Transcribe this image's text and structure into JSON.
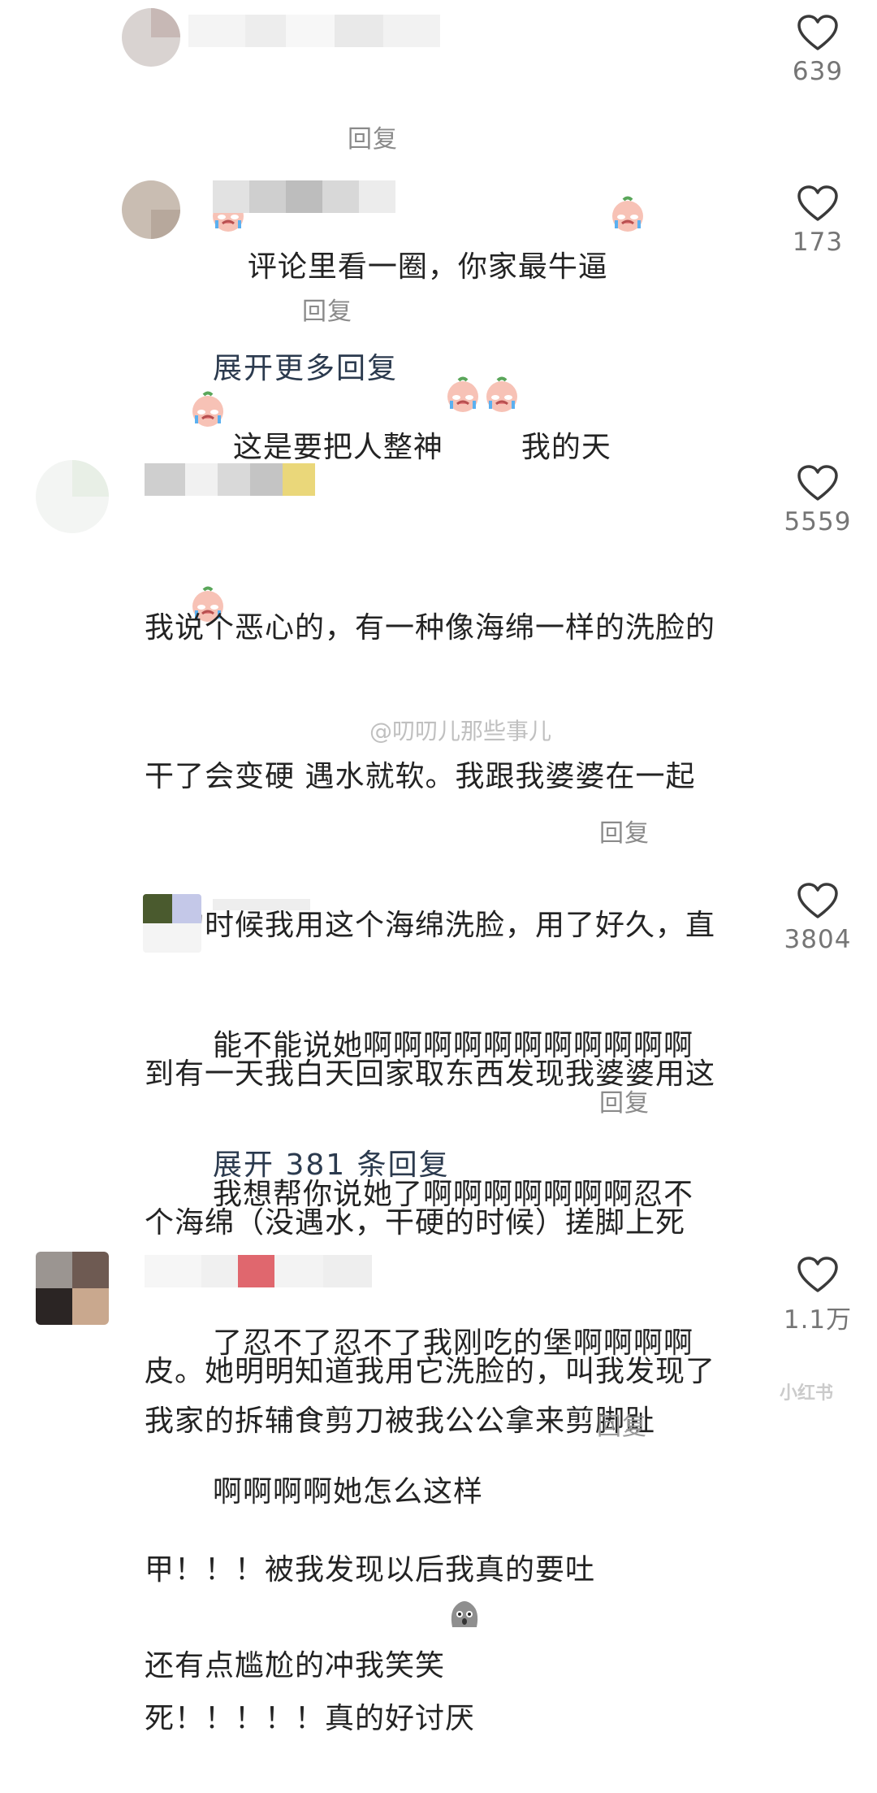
{
  "comments": [
    {
      "text": "评论里看一圈，你家最牛逼",
      "reply_label": "回复",
      "likes": "639"
    },
    {
      "text_before_emoji": "这是要把人整神",
      "text_after_emoji": "我的天",
      "reply_label": "回复",
      "likes": "173"
    },
    {
      "expand_label": "展开更多回复"
    },
    {
      "lines": [
        "我说个恶心的，有一种像海绵一样的洗脸的",
        "干了会变硬 遇水就软。我跟我婆婆在一起",
        "住的时候我用这个海绵洗脸，用了好久，直",
        "到有一天我白天回家取东西发现我婆婆用这",
        "个海绵（没遇水，干硬的时候）搓脚上死",
        "皮。她明明知道我用它洗脸的，叫我发现了",
        "还有点尴尬的冲我笑笑"
      ],
      "reply_label": "回复",
      "likes": "5559"
    },
    {
      "lines": [
        "能不能说她啊啊啊啊啊啊啊啊啊啊啊",
        "我想帮你说她了啊啊啊啊啊啊啊忍不",
        "了忍不了忍不了我刚吃的堡啊啊啊啊",
        "啊啊啊啊她怎么这样"
      ],
      "reply_label": "回复",
      "likes": "3804"
    },
    {
      "expand_label": "展开 381 条回复"
    },
    {
      "lines": [
        "我家的拆辅食剪刀被我公公拿来剪脚趾",
        "甲！！！被我发现以后我真的要吐",
        "死！！！！！真的好讨厌"
      ],
      "reply_label": "回复",
      "likes": "1.1万"
    }
  ],
  "watermark": "@叨叨儿那些事儿",
  "corner_watermark": "小红书",
  "colors": {
    "text": "#232323",
    "reply": "#8a8a8a",
    "expand": "#2b3a4e",
    "like_count": "#757575",
    "heart_stroke": "#3a3a3a"
  },
  "icons": {
    "like": "heart-outline-icon",
    "emoji_cry": "crying-face-emoji",
    "emoji_awkward": "awkward-face-emoji"
  }
}
